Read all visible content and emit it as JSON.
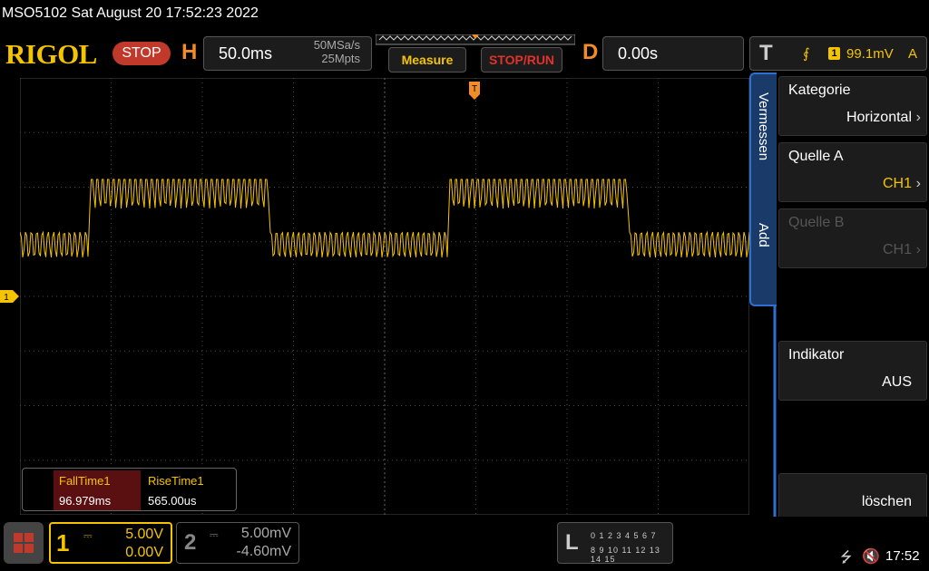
{
  "titlebar": {
    "text": "MSO5102  Sat August 20 17:52:23 2022"
  },
  "brand": {
    "logo": "RIGOL",
    "status": "STOP"
  },
  "horizontal": {
    "letter": "H",
    "timebase": "50.0ms",
    "sample_rate": "50MSa/s",
    "mem_depth": "25Mpts"
  },
  "buttons": {
    "measure": "Measure",
    "stop_run": "STOP/RUN"
  },
  "delay": {
    "letter": "D",
    "value": "0.00s"
  },
  "trigger": {
    "letter": "T",
    "edge_icon": "rising-edge-icon",
    "edge_glyph": "⨐",
    "source": "1",
    "level": "99.1mV",
    "mode": "A"
  },
  "measurements": [
    {
      "name": "FallTime1",
      "value": "96.979ms"
    },
    {
      "name": "RiseTime1",
      "value": "565.00us"
    }
  ],
  "side_menu": {
    "tabs": [
      "Vermessen",
      "Add"
    ],
    "keys": [
      {
        "title": "Kategorie",
        "value": "Horizontal",
        "enabled": true
      },
      {
        "title": "Quelle A",
        "value": "CH1",
        "enabled": true
      },
      {
        "title": "Quelle B",
        "value": "CH1",
        "enabled": false
      },
      {
        "title": "Indikator",
        "value": "AUS",
        "enabled": true
      },
      {
        "title": "",
        "value": "löschen",
        "enabled": true
      }
    ]
  },
  "channels": {
    "ch1": {
      "num": "1",
      "scale": "5.00V",
      "offset": "0.00V",
      "color": "#f5c400"
    },
    "ch2": {
      "num": "2",
      "scale": "5.00mV",
      "offset": "-4.60mV",
      "color": "#888888"
    }
  },
  "logic": {
    "letter": "L",
    "row1": "0 1 2 3  4 5 6 7",
    "row2": "8 9 10 11 12 13 14 15"
  },
  "status": {
    "time": "17:52",
    "usb_icon": "usb-icon",
    "sound_icon": "speaker-muted-icon"
  },
  "colors": {
    "trace": "#f5c400",
    "grid": "#4a4a4a",
    "accent_blue": "#2f6fd0",
    "trigger_orange": "#f28c28"
  }
}
